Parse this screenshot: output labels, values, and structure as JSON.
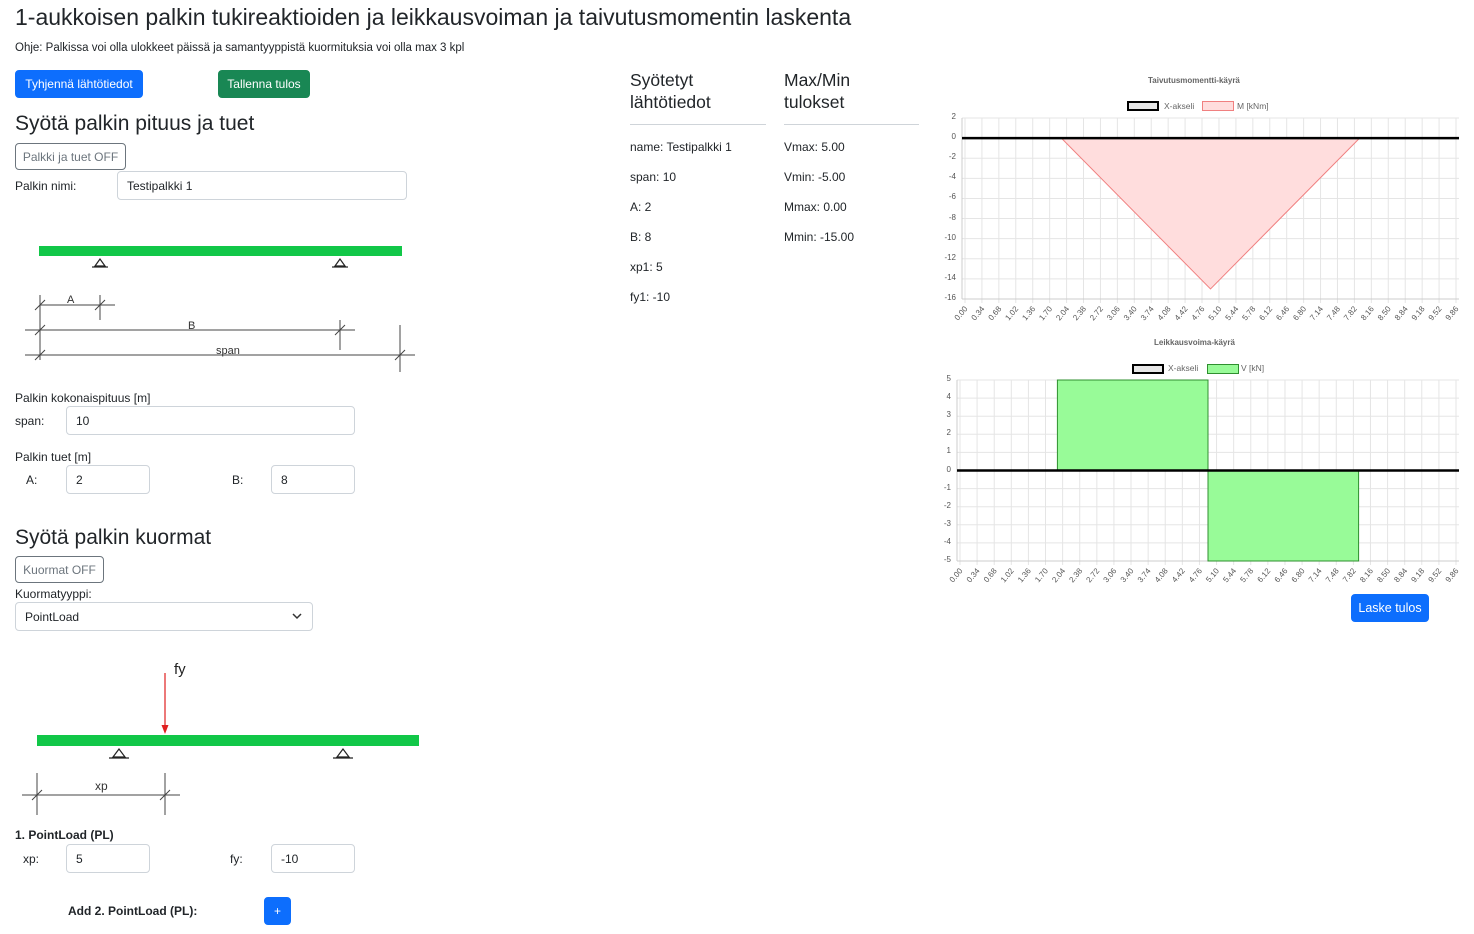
{
  "header": {
    "title": "1-aukkoisen palkin tukireaktioiden ja leikkausvoiman ja taivutusmomentin laskenta",
    "instructions": "Ohje: Palkissa voi olla ulokkeet päissä ja samantyyppistä kuormituksia voi olla max 3 kpl"
  },
  "buttons": {
    "clear": "Tyhjennä lähtötiedot",
    "save": "Tallenna tulos",
    "calc": "Laske tulos"
  },
  "beam_section": {
    "title": "Syötä palkin pituus ja tuet",
    "toggle": "Palkki ja tuet OFF",
    "name_label": "Palkin nimi:",
    "name_value": "Testipalkki 1",
    "diagram_labels": {
      "a": "A",
      "b": "B",
      "span": "span"
    },
    "length_heading": "Palkin kokonaispituus [m]",
    "span_label": "span:",
    "span_value": "10",
    "supports_heading": "Palkin tuet [m]",
    "a_label": "A:",
    "a_value": "2",
    "b_label": "B:",
    "b_value": "8"
  },
  "load_section": {
    "title": "Syötä palkin kuormat",
    "toggle": "Kuormat OFF",
    "type_label": "Kuormatyyppi:",
    "type_value": "PointLoad",
    "diagram_labels": {
      "fy": "fy",
      "xp": "xp"
    },
    "load_heading": "1. PointLoad (PL)",
    "xp_label": "xp:",
    "xp_value": "5",
    "fy_label": "fy:",
    "fy_value": "-10",
    "add_label": "Add 2. PointLoad (PL):",
    "add_button": "+"
  },
  "inputs_column": {
    "heading": "Syötetyt lähtötiedot",
    "lines": [
      "name: Testipalkki 1",
      "span: 10",
      "A: 2",
      "B: 8",
      "xp1: 5",
      "fy1: -10"
    ]
  },
  "results_column": {
    "heading": "Max/Min tulokset",
    "lines": [
      "Vmax: 5.00",
      "Vmin: -5.00",
      "Mmax: 0.00",
      "Mmin: -15.00"
    ]
  },
  "colors": {
    "beam": "#11c748",
    "moment_fill": "#ffdddd",
    "moment_line": "#f08080",
    "shear_fill": "#98fb98",
    "shear_line": "#2f8f2f"
  },
  "chart_data": [
    {
      "type": "area",
      "title": "Taivutusmomentti-käyrä",
      "legend": [
        "X-akseli",
        "M [kNm]"
      ],
      "x_ticks": [
        "0.00",
        "0.34",
        "0.68",
        "1.02",
        "1.36",
        "1.70",
        "2.04",
        "2.38",
        "2.72",
        "3.06",
        "3.40",
        "3.74",
        "4.08",
        "4.42",
        "4.76",
        "5.10",
        "5.44",
        "5.78",
        "6.12",
        "6.46",
        "6.80",
        "7.14",
        "7.48",
        "7.82",
        "8.16",
        "8.50",
        "8.84",
        "9.18",
        "9.52",
        "9.86"
      ],
      "y_ticks": [
        "2",
        "0",
        "-2",
        "-4",
        "-6",
        "-8",
        "-10",
        "-12",
        "-14",
        "-16"
      ],
      "ylim": [
        -16,
        2
      ],
      "xlim": [
        0,
        10
      ],
      "series": [
        {
          "name": "M [kNm]",
          "x": [
            0,
            2,
            5,
            8,
            10
          ],
          "y": [
            0,
            0,
            -15,
            0,
            0
          ]
        }
      ]
    },
    {
      "type": "area",
      "title": "Leikkausvoima-käyrä",
      "legend": [
        "X-akseli",
        "V [kN]"
      ],
      "x_ticks": [
        "0.00",
        "0.34",
        "0.68",
        "1.02",
        "1.36",
        "1.70",
        "2.04",
        "2.38",
        "2.72",
        "3.06",
        "3.40",
        "3.74",
        "4.08",
        "4.42",
        "4.76",
        "5.10",
        "5.44",
        "5.78",
        "6.12",
        "6.46",
        "6.80",
        "7.14",
        "7.48",
        "7.82",
        "8.16",
        "8.50",
        "8.84",
        "9.18",
        "9.52",
        "9.86"
      ],
      "y_ticks": [
        "5",
        "4",
        "3",
        "2",
        "1",
        "0",
        "-1",
        "-2",
        "-3",
        "-4",
        "-5"
      ],
      "ylim": [
        -5,
        5
      ],
      "xlim": [
        0,
        10
      ],
      "series": [
        {
          "name": "V [kN]",
          "x": [
            0,
            2,
            2,
            5,
            5,
            8,
            8,
            10
          ],
          "y": [
            0,
            0,
            5,
            5,
            -5,
            -5,
            0,
            0
          ]
        }
      ]
    }
  ]
}
